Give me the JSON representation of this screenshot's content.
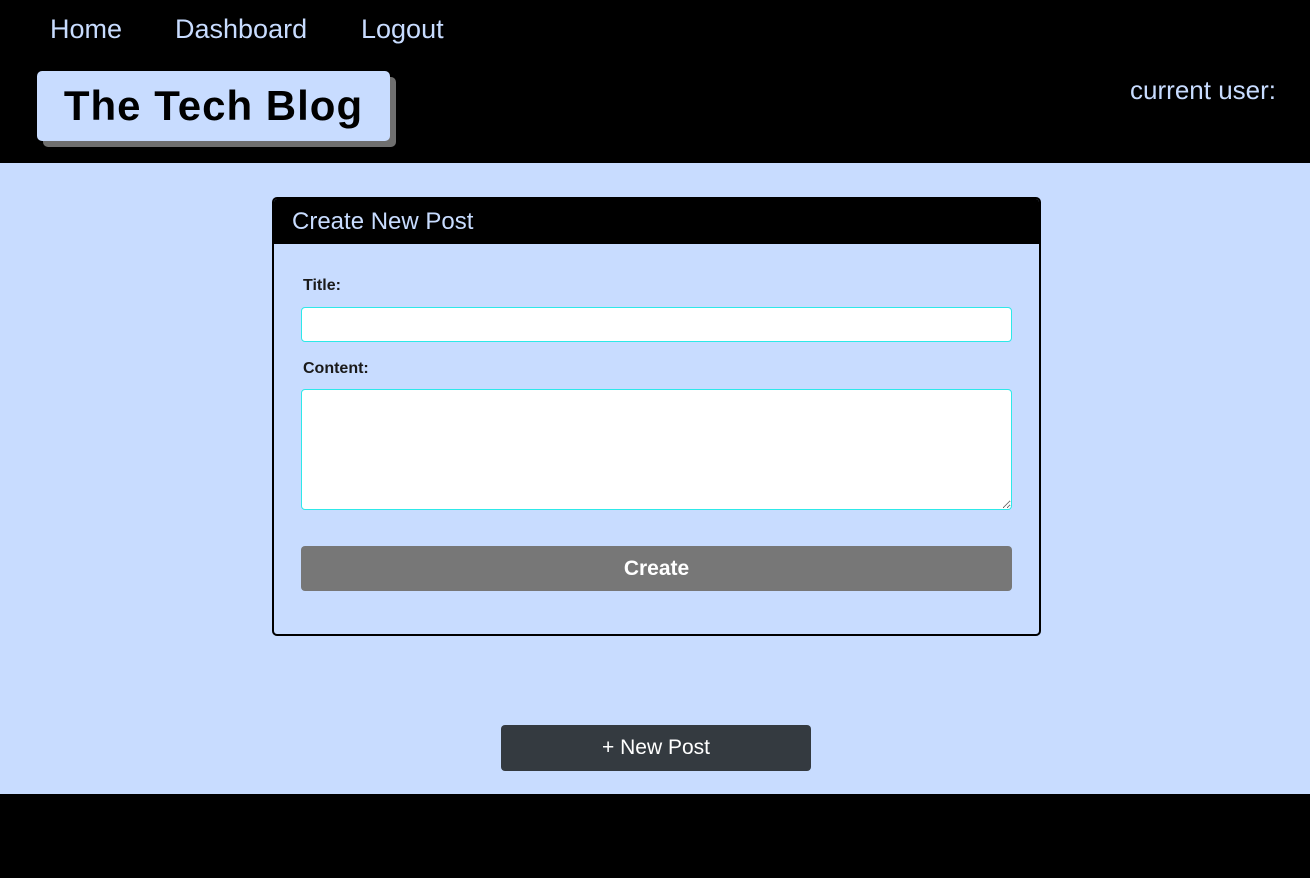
{
  "nav": {
    "home_label": "Home",
    "dashboard_label": "Dashboard",
    "logout_label": "Logout"
  },
  "header": {
    "site_title": "The Tech Blog",
    "current_user_label": "current user:"
  },
  "new_post_form": {
    "heading": "Create New Post",
    "title_label": "Title:",
    "title_value": "",
    "content_label": "Content:",
    "content_value": "",
    "submit_label": "Create"
  },
  "actions": {
    "new_post_label": "+ New Post"
  },
  "colors": {
    "page_background": "#c8dcff",
    "header_background": "#000000",
    "link_color": "#c8dcff",
    "input_border": "#2ee8e8",
    "create_button": "#777777",
    "new_post_button": "#343a40"
  }
}
